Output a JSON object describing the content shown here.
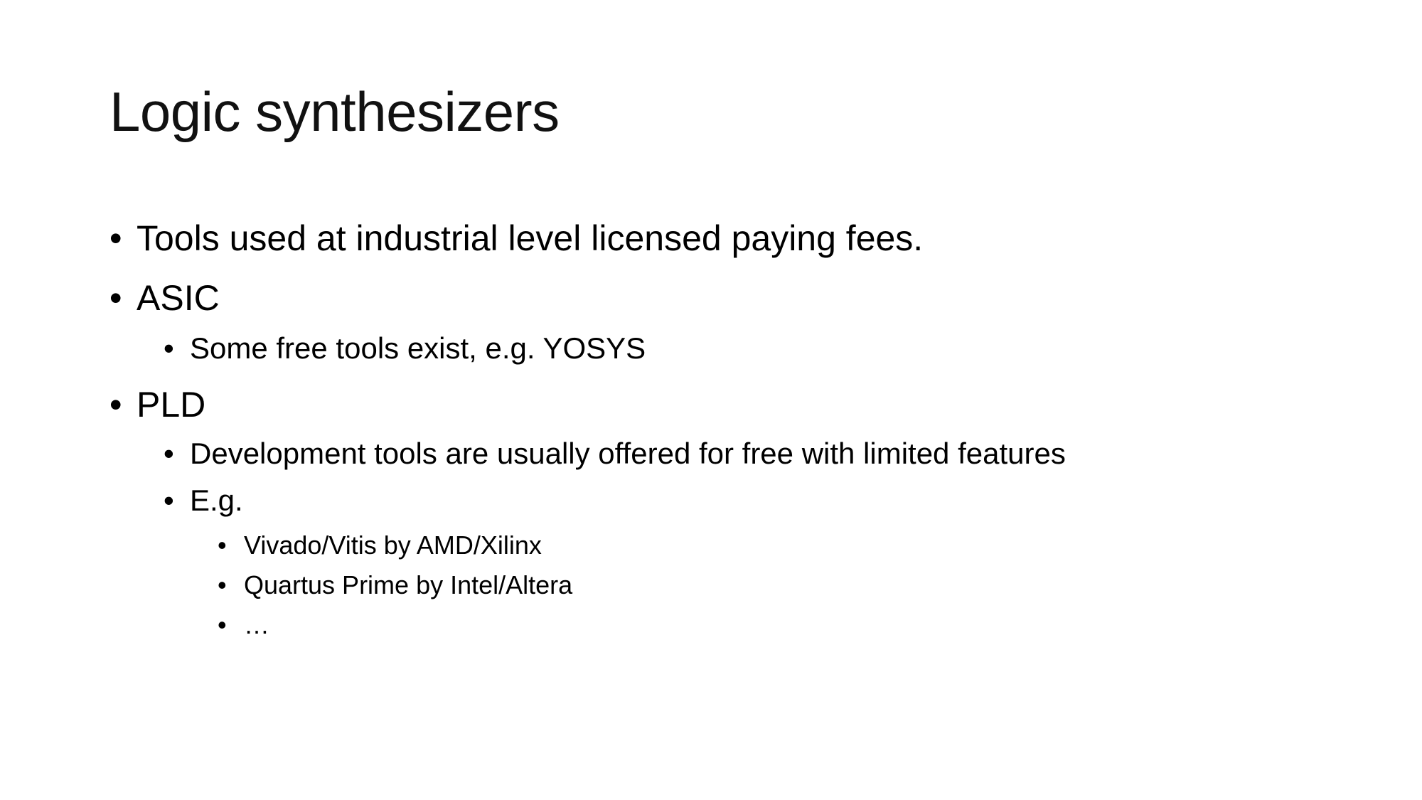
{
  "slide": {
    "title": "Logic synthesizers",
    "bullet_glyph": "•",
    "items": [
      {
        "text": "Tools used at industrial level licensed paying fees."
      },
      {
        "text": "ASIC"
      },
      {
        "text": "Some free tools exist, e.g. YOSYS"
      },
      {
        "text": "PLD"
      },
      {
        "text": "Development tools are usually offered for free with limited features"
      },
      {
        "text": "E.g."
      },
      {
        "text": "Vivado/Vitis by AMD/Xilinx"
      },
      {
        "text": "Quartus Prime by Intel/Altera"
      },
      {
        "text": "…"
      }
    ]
  }
}
